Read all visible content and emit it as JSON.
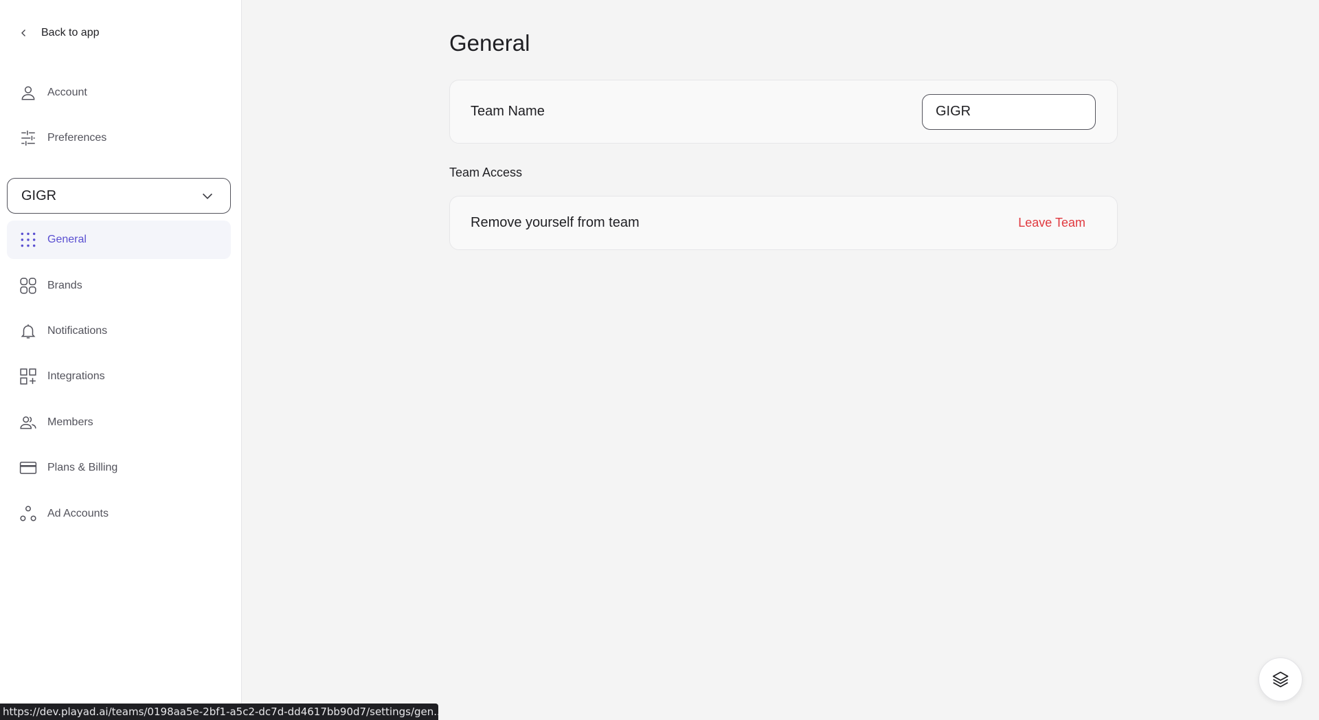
{
  "sidebar": {
    "back_label": "Back to app",
    "account_items": [
      {
        "label": "Account",
        "icon": "user-icon"
      },
      {
        "label": "Preferences",
        "icon": "sliders-icon"
      }
    ],
    "team_selector": {
      "value": "GIGR"
    },
    "team_items": [
      {
        "label": "General",
        "icon": "grid-dots-icon",
        "active": true
      },
      {
        "label": "Brands",
        "icon": "grid-squares-icon"
      },
      {
        "label": "Notifications",
        "icon": "bell-icon"
      },
      {
        "label": "Integrations",
        "icon": "grid-plus-icon"
      },
      {
        "label": "Members",
        "icon": "users-icon"
      },
      {
        "label": "Plans & Billing",
        "icon": "credit-card-icon"
      },
      {
        "label": "Ad Accounts",
        "icon": "circles-icon"
      }
    ]
  },
  "main": {
    "title": "General",
    "team_name": {
      "label": "Team Name",
      "value": "GIGR"
    },
    "team_access": {
      "heading": "Team Access",
      "label": "Remove yourself from team",
      "action": "Leave Team"
    }
  },
  "status_bar": {
    "url": "https://dev.playad.ai/teams/0198aa5e-2bf1-a5c2-dc7d-dd4617bb90d7/settings/gen..."
  },
  "colors": {
    "accent": "#5a4fd1",
    "danger": "#e0383e",
    "background": "#f4f4f4"
  }
}
